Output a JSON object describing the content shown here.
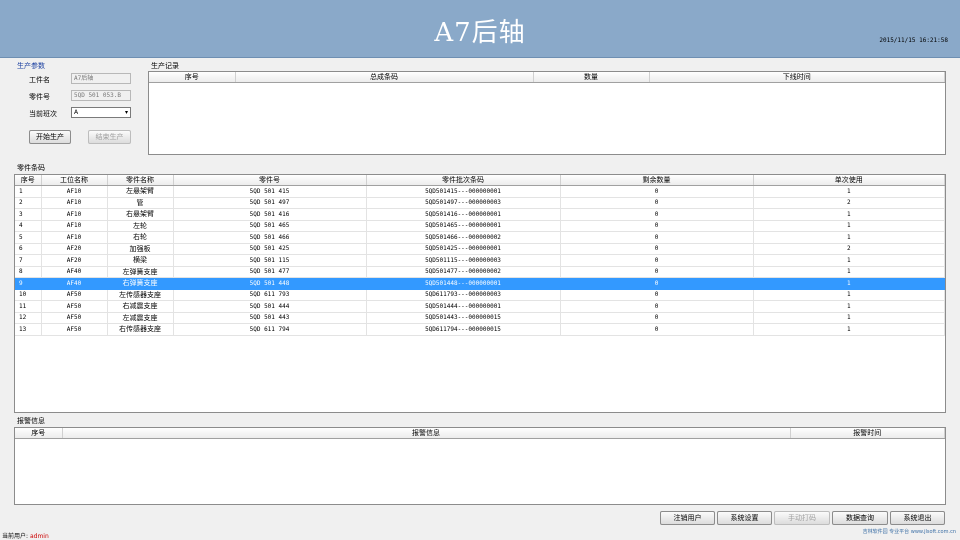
{
  "header": {
    "title": "A7后轴",
    "datetime": "2015/11/15 16:21:58"
  },
  "production_params": {
    "label": "生产参数",
    "workpiece_label": "工件名",
    "workpiece_value": "A7后轴",
    "part_no_label": "零件号",
    "part_no_value": "5QD 501 053.B",
    "shift_label": "当前班次",
    "shift_value": "A",
    "start_button": "开始生产",
    "end_button": "结束生产"
  },
  "production_record": {
    "label": "生产记录",
    "columns": [
      "序号",
      "总成条码",
      "数量",
      "下线时间"
    ]
  },
  "parts_barcode": {
    "label": "零件条码",
    "columns": [
      "序号",
      "工位名称",
      "零件名称",
      "零件号",
      "零件批次条码",
      "剩余数量",
      "单次使用"
    ],
    "rows": [
      [
        "1",
        "AF10",
        "左悬架臂",
        "5QD 501 415",
        "5QD501415---000000001",
        "0",
        "1"
      ],
      [
        "2",
        "AF10",
        "管",
        "5QD 501 497",
        "5QD501497---000000003",
        "0",
        "2"
      ],
      [
        "3",
        "AF10",
        "右悬架臂",
        "5QD 501 416",
        "5QD501416---000000001",
        "0",
        "1"
      ],
      [
        "4",
        "AF10",
        "左轮",
        "5QD 501 465",
        "5QD501465---000000001",
        "0",
        "1"
      ],
      [
        "5",
        "AF10",
        "右轮",
        "5QD 501 466",
        "5QD501466---000000002",
        "0",
        "1"
      ],
      [
        "6",
        "AF20",
        "加强板",
        "5QD 501 425",
        "5QD501425---000000001",
        "0",
        "2"
      ],
      [
        "7",
        "AF20",
        "横梁",
        "5QD 501 115",
        "5QD501115---000000003",
        "0",
        "1"
      ],
      [
        "8",
        "AF40",
        "左弹簧支座",
        "5QD 501 477",
        "5QD501477---000000002",
        "0",
        "1"
      ],
      [
        "9",
        "AF40",
        "右弹簧支座",
        "5QD 501 448",
        "5QD501448---000000001",
        "0",
        "1"
      ],
      [
        "10",
        "AF50",
        "左传感器支座",
        "5QD 611 793",
        "5QD611793---000000003",
        "0",
        "1"
      ],
      [
        "11",
        "AF50",
        "右减震支座",
        "5QD 501 444",
        "5QD501444---000000001",
        "0",
        "1"
      ],
      [
        "12",
        "AF50",
        "左减震支座",
        "5QD 501 443",
        "5QD501443---000000015",
        "0",
        "1"
      ],
      [
        "13",
        "AF50",
        "右传感器支座",
        "5QD 611 794",
        "5QD611794---000000015",
        "0",
        "1"
      ]
    ],
    "selected_index": 8
  },
  "alarm_info": {
    "label": "报警信息",
    "columns": [
      "序号",
      "报警信息",
      "报警时间"
    ]
  },
  "bottom_buttons": {
    "logout": "注销用户",
    "settings": "系统设置",
    "manual_print": "手动打码",
    "data_query": "数据查询",
    "exit": "系统退出"
  },
  "footer": {
    "user_label": "当前用户:",
    "user_name": "admin",
    "watermark": "吉林软件园 专业平台 www.jlsoft.com.cn"
  },
  "colors": {
    "header_bg": "#8aa9c9",
    "selected_row": "#3399ff",
    "section_label_blue": "#1a3fa0",
    "user_name": "#cc0000"
  }
}
